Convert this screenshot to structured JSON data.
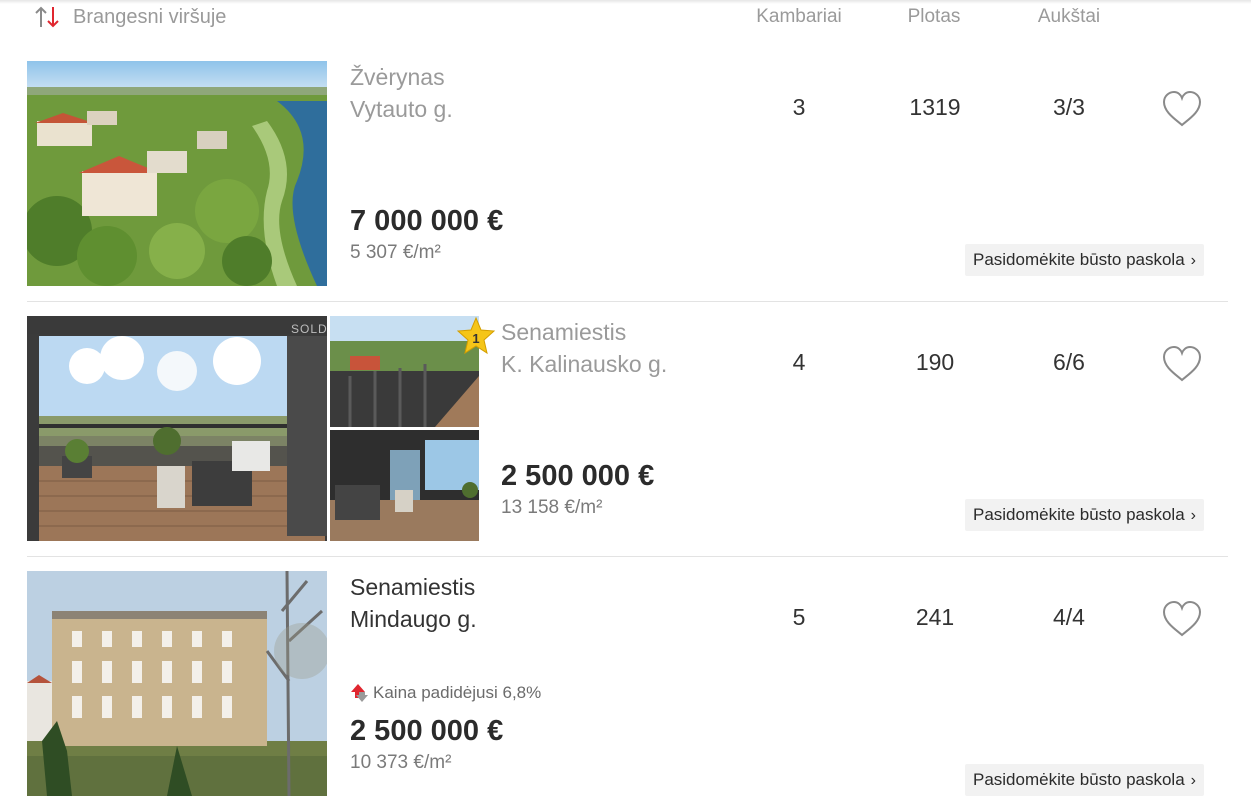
{
  "header": {
    "sort_label": "Brangesni viršuje",
    "col_rooms": "Kambariai",
    "col_area": "Plotas",
    "col_floors": "Aukštai"
  },
  "loan_label": "Pasidomėkite būsto paskola",
  "listings": [
    {
      "district": "Žvėrynas",
      "street": "Vytauto g.",
      "price": "7 000 000 €",
      "price_per_sqm": "5 307 €/m²",
      "rooms": "3",
      "area": "1319",
      "floors": "3/3"
    },
    {
      "district": "Senamiestis",
      "street": "K. Kalinausko g.",
      "price": "2 500 000 €",
      "price_per_sqm": "13 158 €/m²",
      "rooms": "4",
      "area": "190",
      "floors": "6/6",
      "badge": "1",
      "sold_mark": "SOLD"
    },
    {
      "district": "Senamiestis",
      "street": "Mindaugo g.",
      "price": "2 500 000 €",
      "price_per_sqm": "10 373 €/m²",
      "rooms": "5",
      "area": "241",
      "floors": "4/4",
      "price_change": "Kaina padidėjusi 6,8%"
    }
  ],
  "colors": {
    "accent_red": "#e0262f",
    "badge_yellow": "#f5c518"
  },
  "icons": [
    "sort-arrows-icon",
    "heart-icon",
    "chevron-right-icon",
    "star-badge-icon",
    "price-up-icon"
  ]
}
